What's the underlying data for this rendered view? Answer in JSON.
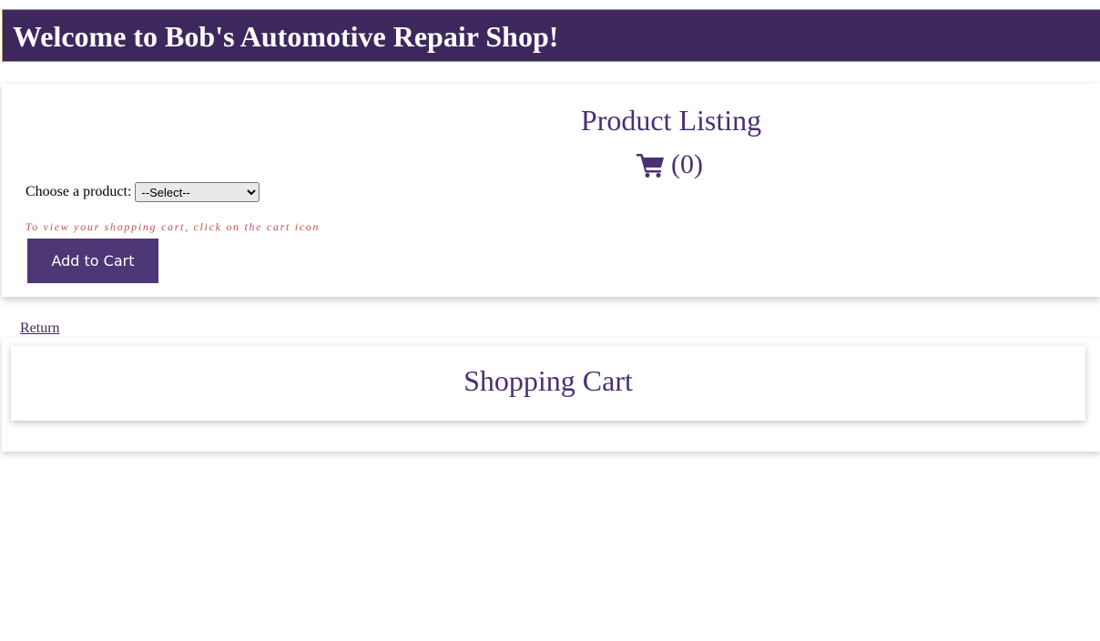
{
  "header": {
    "title": "Welcome to Bob's Automotive Repair Shop!"
  },
  "product_listing": {
    "title": "Product Listing",
    "cart_icon": "shopping-cart-icon",
    "cart_count": "(0)",
    "choose_label": "Choose a product:",
    "select_value": "--Select--",
    "hint": "To view your shopping cart, click on the cart icon",
    "add_button_label": "Add to Cart"
  },
  "return_link": "Return",
  "shopping_cart": {
    "title": "Shopping Cart"
  },
  "colors": {
    "header_bg": "#3d285e",
    "accent": "#4a2f73",
    "button_bg": "#4e3777",
    "hint_text": "#c0504d"
  }
}
